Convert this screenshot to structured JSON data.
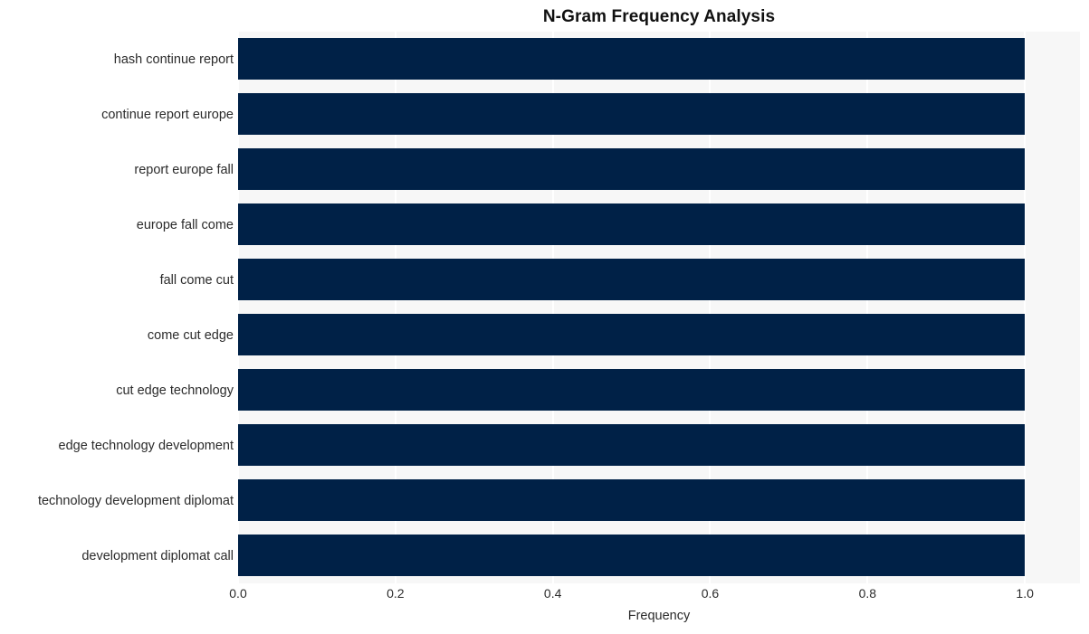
{
  "chart_data": {
    "type": "bar",
    "orientation": "horizontal",
    "title": "N-Gram Frequency Analysis",
    "xlabel": "Frequency",
    "ylabel": "",
    "categories": [
      "hash continue report",
      "continue report europe",
      "report europe fall",
      "europe fall come",
      "fall come cut",
      "come cut edge",
      "cut edge technology",
      "edge technology development",
      "technology development diplomat",
      "development diplomat call"
    ],
    "values": [
      1.0,
      1.0,
      1.0,
      1.0,
      1.0,
      1.0,
      1.0,
      1.0,
      1.0,
      1.0
    ],
    "xlim": [
      0.0,
      1.07
    ],
    "xticks": [
      0.0,
      0.2,
      0.4,
      0.6,
      0.8,
      1.0
    ],
    "xticklabels": [
      "0.0",
      "0.2",
      "0.4",
      "0.6",
      "0.8",
      "1.0"
    ],
    "grid": true,
    "grid_axis": "x",
    "legend": false,
    "bar_color": "#002147",
    "plot_background": "#f7f7f7",
    "figure_background": "#ffffff",
    "gridline_color": "#ffffff",
    "text_color": "#2b2b2b",
    "title_color": "#111111"
  }
}
